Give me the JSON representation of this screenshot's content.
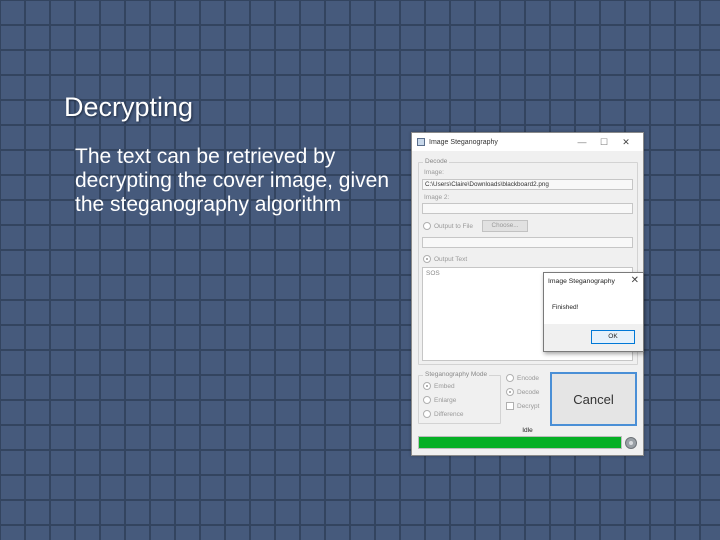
{
  "slide": {
    "title": "Decrypting",
    "body": "The text can be retrieved by decrypting the cover image, given the steganography algorithm"
  },
  "window": {
    "title": "Image Steganography",
    "controls": {
      "minimize": "—",
      "maximize": "☐",
      "close": "✕"
    },
    "decode_group": {
      "legend": "Decode",
      "image_label": "Image:",
      "image_value": "C:\\Users\\Claire\\Downloads\\blackboard2.png",
      "image2_label": "Image 2:",
      "image2_value": "",
      "output_to_file_label": "Output to File",
      "choose_button": "Choose...",
      "file_path_value": "",
      "output_text_label": "Output Text",
      "output_text_value": "SOS"
    },
    "mode_group": {
      "legend": "Steganography Mode",
      "options": [
        "Embed",
        "Enlarge",
        "Difference"
      ]
    },
    "operation": {
      "encode_label": "Encode",
      "decode_label": "Decode",
      "decrypt_label": "Decrypt",
      "selected": "Decode"
    },
    "cancel_button": "Cancel",
    "status": "Idle",
    "progress": 1.0,
    "progress_color": "#06b025"
  },
  "message_box": {
    "title": "Image Steganography",
    "close": "✕",
    "message": "Finished!",
    "ok_button": "OK"
  }
}
